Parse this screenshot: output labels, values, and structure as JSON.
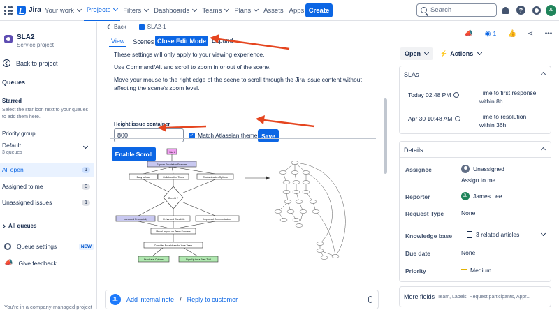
{
  "topbar": {
    "logo_text": "Jira",
    "nav": [
      "Your work",
      "Projects",
      "Filters",
      "Dashboards",
      "Teams",
      "Plans",
      "Assets",
      "Apps"
    ],
    "active_nav": "Projects",
    "create_label": "Create",
    "search_placeholder": "Search",
    "avatar_initials": "JL"
  },
  "sidebar": {
    "project_name": "SLA2",
    "project_type": "Service project",
    "back_label": "Back to project",
    "queues_heading": "Queues",
    "starred_heading": "Starred",
    "starred_note": "Select the star icon next to your queues to add them here.",
    "priority_heading": "Priority group",
    "group_name": "Default",
    "group_count": "3 queues",
    "queues": [
      {
        "label": "All open",
        "count": "1"
      },
      {
        "label": "Assigned to me",
        "count": "0"
      },
      {
        "label": "Unassigned issues",
        "count": "1"
      }
    ],
    "all_queues": "All queues",
    "queue_settings": "Queue settings",
    "new_badge": "NEW",
    "give_feedback": "Give feedback",
    "footer": "You're in a company-managed project"
  },
  "main": {
    "back_label": "Back",
    "issue_key": "SLA2-1",
    "tabs": [
      "View",
      "Scenes"
    ],
    "close_edit": "Close Edit Mode",
    "expand": "Expand",
    "text1": "These settings will only apply to your viewing experience.",
    "text2": "Use Command/Alt and scroll to zoom in or out of the scene.",
    "text3": "Move your mouse to the right edge of the scene to scroll through the Jira issue content without affecting the scene's zoom level.",
    "height_label": "Height issue container",
    "height_value": "800",
    "match_theme": "Match Atlassian theme",
    "save_label": "Save",
    "enable_scroll": "Enable Scroll",
    "flow": {
      "start": "Start",
      "explore": "Explore Escalation Features",
      "easy": "Easy to Use",
      "collab": "Collaboration Tools",
      "custom": "Customization Options",
      "benefit": "Benefit ?",
      "prod": "Increased Productivity",
      "creat": "Enhanced Creativity",
      "comm": "Improved Communication",
      "impact": "Visual Impact on Team Success",
      "consider": "Consider Excalidraw for Your Team",
      "purchase": "Purchase Options",
      "signup": "Sign Up for a Free Trial"
    },
    "comment_avatar": "JL",
    "add_note": "Add internal note",
    "sep": "/",
    "reply": "Reply to customer"
  },
  "right": {
    "watch_count": "1",
    "status": "Open",
    "actions": "Actions",
    "slas_title": "SLAs",
    "slas": [
      {
        "time": "Today 02:48 PM",
        "desc1": "Time to first response",
        "desc2": "within 8h"
      },
      {
        "time": "Apr 30 10:48 AM",
        "desc1": "Time to resolution",
        "desc2": "within 36h"
      }
    ],
    "details_title": "Details",
    "assignee_label": "Assignee",
    "assignee_value": "Unassigned",
    "assign_me": "Assign to me",
    "reporter_label": "Reporter",
    "reporter_initials": "JL",
    "reporter_value": "James Lee",
    "request_type_label": "Request Type",
    "request_type_value": "None",
    "kb_label": "Knowledge base",
    "kb_value": "3 related articles",
    "due_label": "Due date",
    "due_value": "None",
    "priority_label": "Priority",
    "priority_value": "Medium",
    "more_fields": "More fields",
    "more_fields_sub": "Team, Labels, Request participants, Appr..."
  },
  "colors": {
    "accent": "#0c66e4",
    "annotation_arrow": "#e5451f"
  }
}
